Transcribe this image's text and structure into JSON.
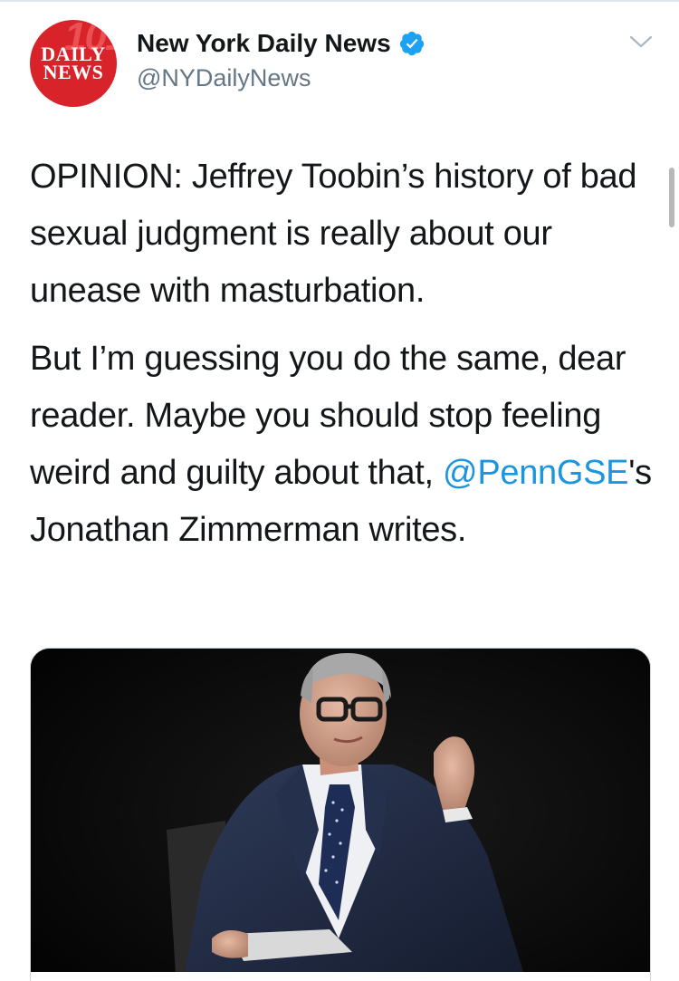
{
  "account": {
    "display_name": "New York Daily News",
    "handle": "@NYDailyNews",
    "verified": true,
    "avatar": {
      "line1": "DAILY",
      "line2": "NEWS",
      "background": "#d8232a"
    }
  },
  "menu": {
    "icon": "chevron-down-icon"
  },
  "tweet": {
    "paragraph1": "OPINION: Jeffrey Toobin’s history of bad sexual judgment is really about our unease with masturbation.",
    "paragraph2_start": "But I’m guessing you do the same, dear reader. Maybe you should stop feeling weird and guilty about that, ",
    "mention": "@PennGSE",
    "paragraph2_end": "'s Jonathan Zimmerman writes."
  },
  "media": {
    "type": "photo"
  },
  "colors": {
    "link": "#1b95e0",
    "secondary_text": "#657786",
    "verified": "#1da1f2",
    "border": "#ccd6dd"
  }
}
